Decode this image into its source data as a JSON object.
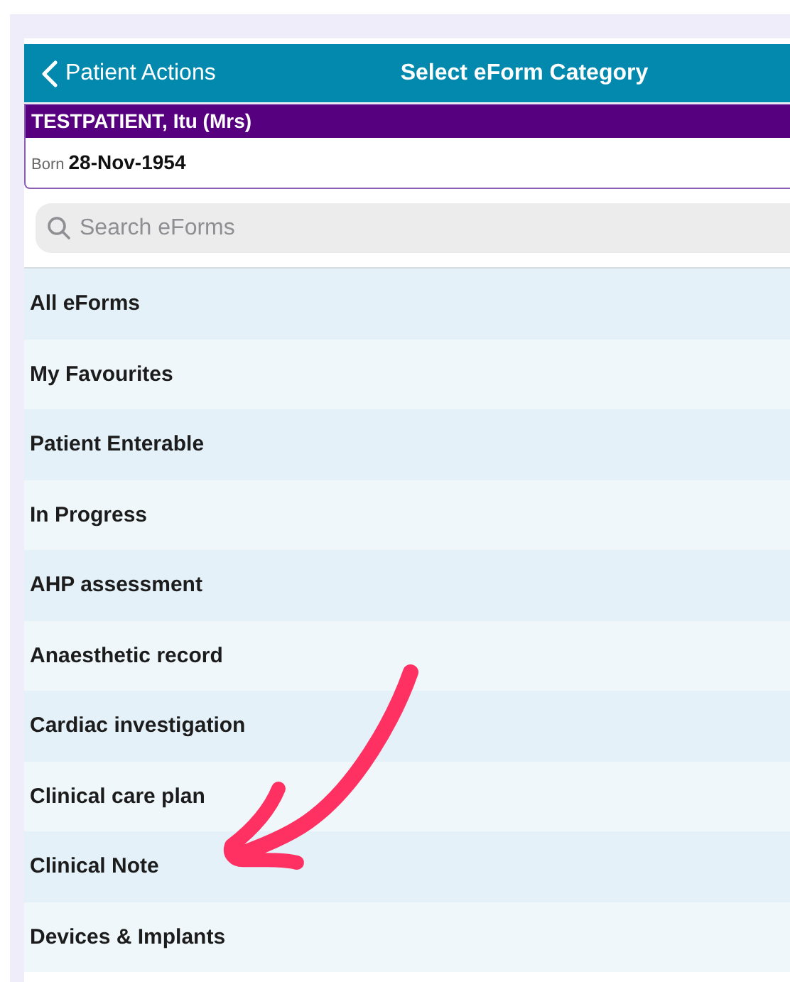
{
  "nav_bar": {
    "back_label": "Patient Actions",
    "title": "Select eForm Category"
  },
  "patient": {
    "name": "TESTPATIENT, Itu (Mrs)",
    "born_label": "Born",
    "born_date": "28-Nov-1954"
  },
  "search": {
    "placeholder": "Search eForms"
  },
  "categories": [
    {
      "label": "All eForms"
    },
    {
      "label": "My Favourites"
    },
    {
      "label": "Patient Enterable"
    },
    {
      "label": "In Progress"
    },
    {
      "label": "AHP assessment"
    },
    {
      "label": "Anaesthetic record"
    },
    {
      "label": "Cardiac investigation"
    },
    {
      "label": "Clinical care plan"
    },
    {
      "label": "Clinical Note"
    },
    {
      "label": "Devices & Implants"
    }
  ]
}
